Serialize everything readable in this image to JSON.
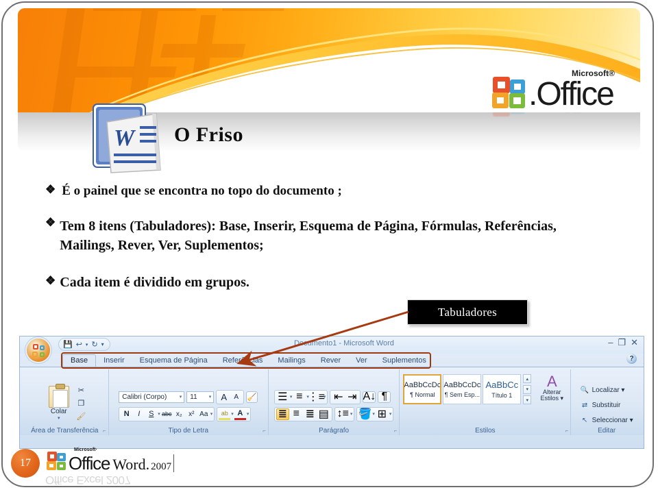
{
  "slide": {
    "title": "O Friso",
    "page_number": "17",
    "bullets": [
      {
        "mark": "❖",
        "text": "É o painel que se encontra no topo do documento ;"
      },
      {
        "mark": "❖",
        "text": "Tem 8 itens (Tabuladores): Base, Inserir, Esquema de Página, Fórmulas, Referências, Mailings, Rever, Ver, Suplementos;"
      },
      {
        "mark": "❖",
        "text": "Cada item é dividido em grupos."
      }
    ],
    "callout": {
      "label": "Tabuladores"
    }
  },
  "header_logo": {
    "office": "Office",
    "dot": ".",
    "microsoft": "Microsoft®"
  },
  "footer_logo": {
    "office": "Office",
    "microsoft": "Microsoft·",
    "word": "Word.",
    "year": "2007",
    "ghost": "Office Excel 2007"
  },
  "word_window": {
    "document_title": "Documento1 - Microsoft Word",
    "window_controls": [
      "–",
      "❐",
      "✕"
    ],
    "help_label": "?",
    "quick_access": [
      "save-icon",
      "undo-icon",
      "redo-icon",
      "customize-icon"
    ],
    "tabs": [
      {
        "label": "Base",
        "active": true
      },
      {
        "label": "Inserir",
        "active": false
      },
      {
        "label": "Esquema de Página",
        "active": false
      },
      {
        "label": "Referências",
        "active": false
      },
      {
        "label": "Mailings",
        "active": false
      },
      {
        "label": "Rever",
        "active": false
      },
      {
        "label": "Ver",
        "active": false
      },
      {
        "label": "Suplementos",
        "active": false
      }
    ],
    "groups": [
      {
        "name": "Área de Transferência",
        "label": "Área de Transferência"
      },
      {
        "name": "Tipo de Letra",
        "label": "Tipo de Letra"
      },
      {
        "name": "Parágrafo",
        "label": "Parágrafo"
      },
      {
        "name": "Estilos",
        "label": "Estilos"
      },
      {
        "name": "Editar",
        "label": "Editar"
      }
    ],
    "clipboard": {
      "paste_label": "Colar",
      "cut_icon": "scissors-icon",
      "copy_icon": "copy-icon",
      "format_painter_icon": "format-painter-icon"
    },
    "font": {
      "font_name": "Calibri (Corpo)",
      "font_size": "11",
      "grow_font": "A",
      "shrink_font": "A",
      "clear_formatting": "clear-formatting-icon",
      "bold": "N",
      "italic": "I",
      "underline": "S",
      "strikethrough": "abc",
      "subscript": "x₂",
      "superscript": "x²",
      "change_case": "Aa",
      "highlight": "ab",
      "font_color": "A"
    },
    "paragraph": {
      "bullets_icon": "bullet-list-icon",
      "numbering_icon": "numbered-list-icon",
      "multilevel_icon": "multilevel-list-icon",
      "decrease_indent_icon": "decrease-indent-icon",
      "increase_indent_icon": "increase-indent-icon",
      "sort_icon": "sort-icon",
      "show_marks_icon": "¶",
      "align_left_icon": "align-left-icon",
      "align_center_icon": "align-center-icon",
      "align_right_icon": "align-right-icon",
      "justify_icon": "justify-icon",
      "line_spacing_icon": "line-spacing-icon",
      "shading_icon": "shading-icon",
      "borders_icon": "borders-icon"
    },
    "styles": [
      {
        "sample": "AaBbCcDc",
        "name": "¶ Normal",
        "selected": true,
        "big": false
      },
      {
        "sample": "AaBbCcDc",
        "name": "¶ Sem Esp...",
        "selected": false,
        "big": false
      },
      {
        "sample": "AaBbCс",
        "name": "Título 1",
        "selected": false,
        "big": true
      }
    ],
    "change_styles": {
      "line1": "Alterar",
      "line2": "Estilos ▾",
      "icon": "change-styles-icon"
    },
    "editing": [
      {
        "label": "Localizar ▾",
        "icon": "find-icon"
      },
      {
        "label": "Substituir",
        "icon": "replace-icon"
      },
      {
        "label": "Seleccionar ▾",
        "icon": "select-icon"
      }
    ]
  }
}
